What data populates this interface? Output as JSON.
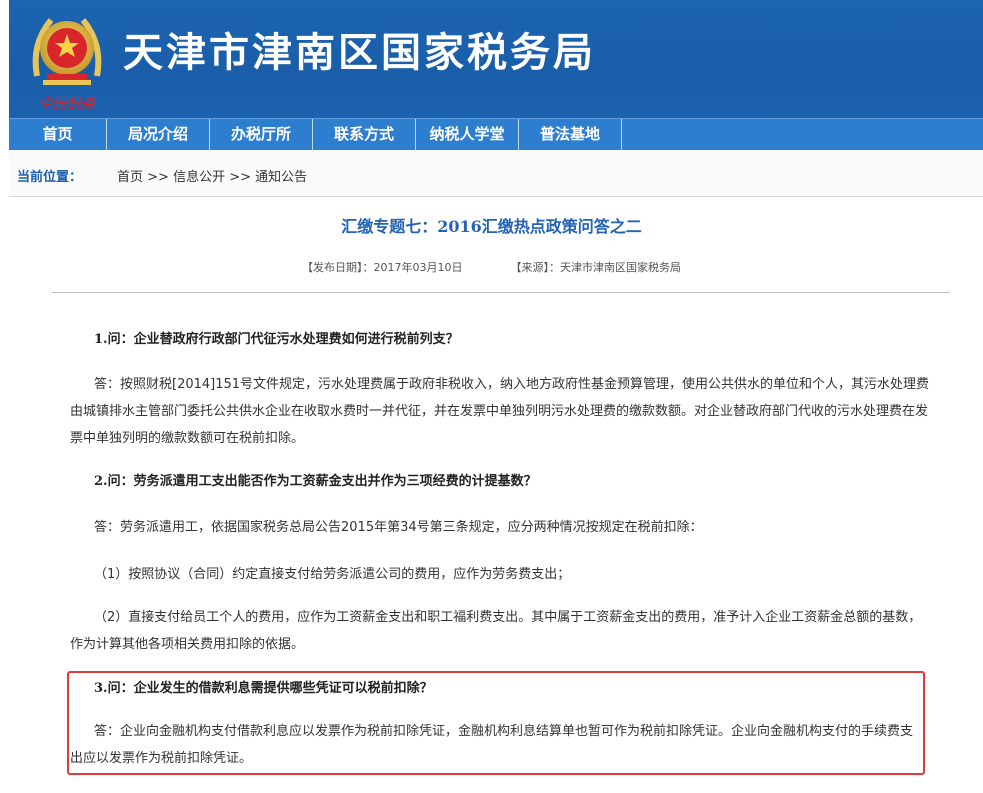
{
  "site": {
    "title": "天津市津南区国家税务局",
    "emblem_text": "中国税务"
  },
  "nav": {
    "items": [
      "首页",
      "局况介绍",
      "办税厅所",
      "联系方式",
      "纳税人学堂",
      "普法基地"
    ]
  },
  "breadcrumb": {
    "label": "当前位置：",
    "home": "首页",
    "sep1": " >> ",
    "section": "信息公开",
    "sep2": " >> ",
    "page": "通知公告"
  },
  "article": {
    "title": "汇缴专题七：2016汇缴热点政策问答之二",
    "publish_date": "【发布日期】：2017年03月10日",
    "source": "【来源】：天津市津南区国家税务局",
    "q1": "1.问：企业替政府行政部门代征污水处理费如何进行税前列支？",
    "a1": "答：按照财税[2014]151号文件规定，污水处理费属于政府非税收入，纳入地方政府性基金预算管理，使用公共供水的单位和个人，其污水处理费由城镇排水主管部门委托公共供水企业在收取水费时一并代征，并在发票中单独列明污水处理费的缴款数额。对企业替政府部门代收的污水处理费在发票中单独列明的缴款数额可在税前扣除。",
    "q2": "2.问：劳务派遣用工支出能否作为工资薪金支出并作为三项经费的计提基数？",
    "a2": "答：劳务派遣用工，依据国家税务总局公告2015年第34号第三条规定，应分两种情况按规定在税前扣除：",
    "a2_1": "（1）按照协议（合同）约定直接支付给劳务派遣公司的费用，应作为劳务费支出；",
    "a2_2": "（2）直接支付给员工个人的费用，应作为工资薪金支出和职工福利费支出。其中属于工资薪金支出的费用，准予计入企业工资薪金总额的基数，作为计算其他各项相关费用扣除的依据。",
    "q3": "3.问：企业发生的借款利息需提供哪些凭证可以税前扣除？",
    "a3": "答：企业向金融机构支付借款利息应以发票作为税前扣除凭证，金融机构利息结算单也暂可作为税前扣除凭证。企业向金融机构支付的手续费支出应以发票作为税前扣除凭证。"
  },
  "colors": {
    "banner": "#1b62ae",
    "nav": "#2d7ecf",
    "title": "#2463b3",
    "highlight": "#e23a3a"
  }
}
